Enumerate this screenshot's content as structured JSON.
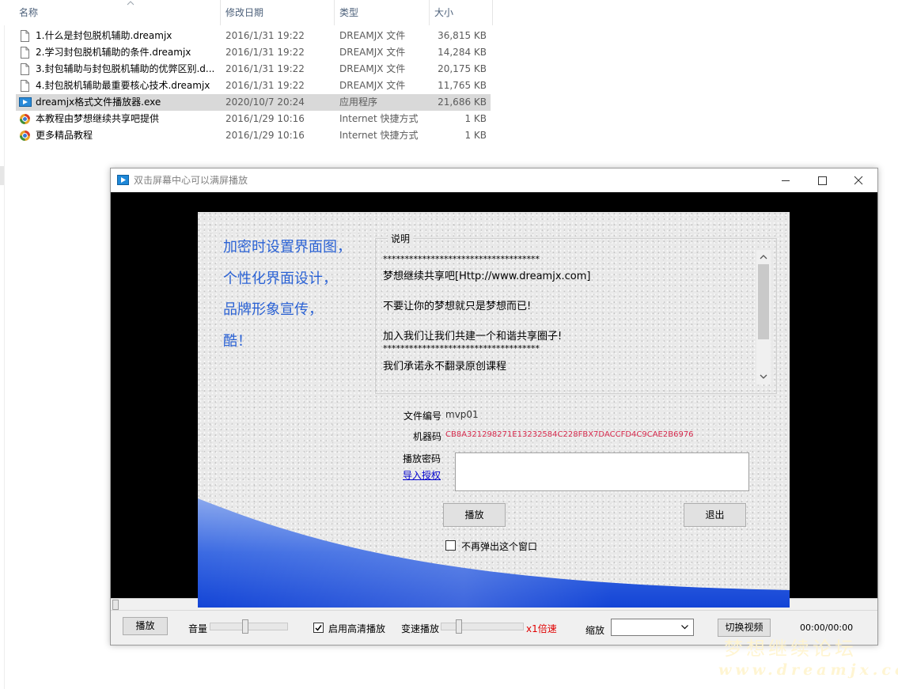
{
  "explorer": {
    "columns": {
      "name": "名称",
      "date": "修改日期",
      "type": "类型",
      "size": "大小"
    },
    "files": [
      {
        "name": "1.什么是封包脱机辅助.dreamjx",
        "date": "2016/1/31 19:22",
        "type": "DREAMJX 文件",
        "size": "36,815 KB",
        "icon": "document-icon"
      },
      {
        "name": "2.学习封包脱机辅助的条件.dreamjx",
        "date": "2016/1/31 19:22",
        "type": "DREAMJX 文件",
        "size": "14,284 KB",
        "icon": "document-icon"
      },
      {
        "name": "3.封包辅助与封包脱机辅助的优弊区别.d...",
        "date": "2016/1/31 19:22",
        "type": "DREAMJX 文件",
        "size": "20,175 KB",
        "icon": "document-icon"
      },
      {
        "name": "4.封包脱机辅助最重要核心技术.dreamjx",
        "date": "2016/1/31 19:22",
        "type": "DREAMJX 文件",
        "size": "11,765 KB",
        "icon": "document-icon"
      },
      {
        "name": "dreamjx格式文件播放器.exe",
        "date": "2020/10/7 20:24",
        "type": "应用程序",
        "size": "21,686 KB",
        "icon": "player-app-icon"
      },
      {
        "name": "本教程由梦想继续共享吧提供",
        "date": "2016/1/29 10:16",
        "type": "Internet 快捷方式",
        "size": "1 KB",
        "icon": "internet-shortcut-icon"
      },
      {
        "name": "更多精品教程",
        "date": "2016/1/29 10:16",
        "type": "Internet 快捷方式",
        "size": "1 KB",
        "icon": "internet-shortcut-icon"
      }
    ],
    "selected_index": 4
  },
  "player": {
    "title": "双击屏幕中心可以满屏播放",
    "controls": {
      "play_label": "播放",
      "volume_label": "音量",
      "volume_level": 0.45,
      "hd_checkbox_label": "启用高清播放",
      "hd_checked": true,
      "speed_label": "变速播放",
      "speed_value": "x1倍速",
      "speed_level": 0.2,
      "zoom_label": "缩放",
      "zoom_selected": "",
      "switch_video_label": "切换视频",
      "time": "00:00/00:00"
    },
    "dialog": {
      "promo_lines": [
        "加密时设置界面图，",
        "个性化界面设计，",
        "品牌形象宣传，",
        "酷！"
      ],
      "notes_title": "说明",
      "notes_lines": [
        "************************************",
        "梦想继续共享吧[Http://www.dreamjx.com]",
        "不要让你的梦想就只是梦想而已!",
        "加入我们让我们共建一个和谐共享圈子!",
        "************************************",
        "我们承诺永不翻录原创课程"
      ],
      "file_no_label": "文件编号",
      "file_no_value": "mvp01",
      "machine_code_label": "机器码",
      "machine_code_value": "CB8A321298271E13232584C228FBX7DACCFD4C9CAE2B6976",
      "play_password_label": "播放密码",
      "import_license_link": "导入授权",
      "password_value": "",
      "play_button": "播放",
      "exit_button": "退出",
      "no_popup_label": "不再弹出这个窗口",
      "no_popup_checked": false
    }
  },
  "watermark": {
    "cn": "梦想继续论坛",
    "url": "www.dreamjx.com"
  },
  "colors": {
    "promo_blue": "#2b62d4",
    "machine_code_red": "#d62a4d",
    "speed_red": "#e00000",
    "link_blue": "#0000cc",
    "selected_row": "#d9d9d9"
  }
}
